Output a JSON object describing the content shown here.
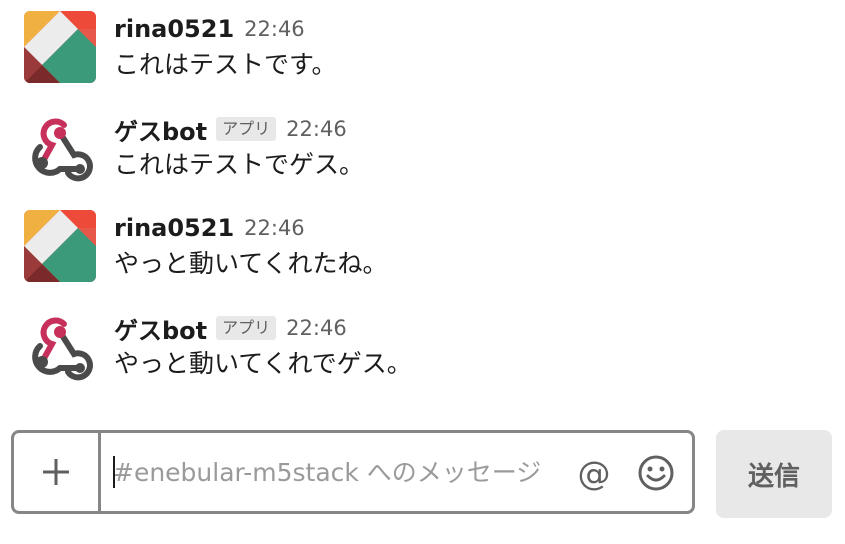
{
  "messages": [
    {
      "username": "rina0521",
      "time": "22:46",
      "text": "これはテストです。",
      "avatar": "user-avatar",
      "badge": null
    },
    {
      "username": "ゲスbot",
      "time": "22:46",
      "text": "これはテストでゲス。",
      "avatar": "webhook-bot-avatar",
      "badge": "アプリ"
    },
    {
      "username": "rina0521",
      "time": "22:46",
      "text": "やっと動いてくれたね。",
      "avatar": "user-avatar",
      "badge": null
    },
    {
      "username": "ゲスbot",
      "time": "22:46",
      "text": "やっと動いてくれでゲス。",
      "avatar": "webhook-bot-avatar",
      "badge": "アプリ"
    }
  ],
  "composer": {
    "placeholder": "#enebular-m5stack へのメッセージ",
    "value": "",
    "attach_icon": "plus-icon",
    "mention_icon": "at-icon",
    "mention_glyph": "@",
    "emoji_icon": "smiley-icon"
  },
  "send_button": {
    "label": "送信"
  },
  "colors": {
    "text": "#1d1c1d",
    "muted": "#616061",
    "badge_bg": "#e8e8e8",
    "bot_pink": "#c7305a",
    "bot_dark": "#4a4a4a",
    "border": "#868686"
  }
}
